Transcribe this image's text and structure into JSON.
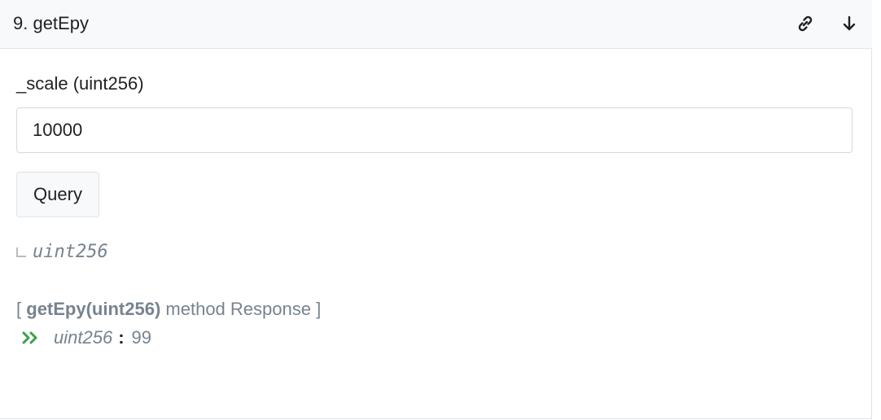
{
  "header": {
    "title": "9. getEpy",
    "icons": [
      "link-icon",
      "arrow-down-icon"
    ]
  },
  "param": {
    "label": "_scale (uint256)",
    "value": "10000",
    "placeholder": "_scale (uint256)"
  },
  "query_button": {
    "label": "Query"
  },
  "output": {
    "type": "uint256"
  },
  "response": {
    "open_bracket": "[",
    "method": "getEpy(uint256)",
    "suffix": "method Response ]",
    "icon": "double-chevron-right-icon",
    "type": "uint256",
    "colon": ":",
    "value": "99"
  },
  "colors": {
    "accent_green": "#3aa24a",
    "muted_text": "#77838f",
    "header_bg": "#f8f9fa"
  }
}
